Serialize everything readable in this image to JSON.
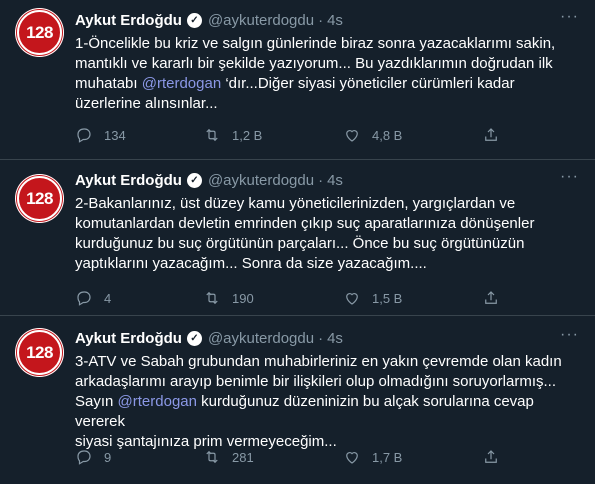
{
  "tweets": [
    {
      "author_name": "Aykut Erdoğdu",
      "author_handle": "@aykuterdogdu",
      "separator": "·",
      "time": "4s",
      "avatar_text": "128",
      "text_line1": "1-Öncelikle bu kriz ve salgın günlerinde biraz sonra yazacaklarımı sakin,",
      "text_line2": "mantıklı ve kararlı bir şekilde yazıyorum... Bu yazdıklarımın doğrudan ilk",
      "text_line3_pre": "muhatabı ",
      "text_line3_mention": "@rterdogan",
      "text_line3_post": " ‘dır...Diğer siyasi yöneticiler cürümleri kadar",
      "text_line4": "üzerlerine alınsınlar...",
      "replies": "134",
      "retweets": "1,2 B",
      "likes": "4,8 B"
    },
    {
      "author_name": "Aykut Erdoğdu",
      "author_handle": "@aykuterdogdu",
      "separator": "·",
      "time": "4s",
      "avatar_text": "128",
      "text_line1": "2-Bakanlarınız, üst düzey kamu yöneticilerinizden, yargıçlardan ve",
      "text_line2": "komutanlardan devletin emrinden çıkıp suç aparatlarınıza dönüşenler",
      "text_line3": "kurduğunuz bu suç örgütünün parçaları... Önce bu suç örgütünüzün",
      "text_line4": "yaptıklarını yazacağım... Sonra da size yazacağım....",
      "replies": "4",
      "retweets": "190",
      "likes": "1,5 B"
    },
    {
      "author_name": "Aykut Erdoğdu",
      "author_handle": "@aykuterdogdu",
      "separator": "·",
      "time": "4s",
      "avatar_text": "128",
      "text_line1": "3-ATV ve Sabah grubundan muhabirleriniz en yakın çevremde olan kadın",
      "text_line2": "arkadaşlarımı arayıp benimle bir ilişkileri olup olmadığını soruyorlarmış...",
      "text_line3_pre": "Sayın ",
      "text_line3_mention": "@rterdogan",
      "text_line3_post": " kurduğunuz düzeninizin bu alçak sorularına cevap vererek",
      "text_line4": "siyasi şantajınıza prim vermeyeceğim...",
      "replies": "9",
      "retweets": "281",
      "likes": "1,7 B"
    }
  ],
  "icons": {
    "more": "more-icon",
    "reply": "reply-icon",
    "retweet": "retweet-icon",
    "like": "heart-icon",
    "share": "share-icon",
    "verified": "verified-icon"
  },
  "colors": {
    "background": "#15202b",
    "avatar": "#c4161c",
    "mention": "#8b98e6",
    "secondary_text": "#8899a6"
  }
}
